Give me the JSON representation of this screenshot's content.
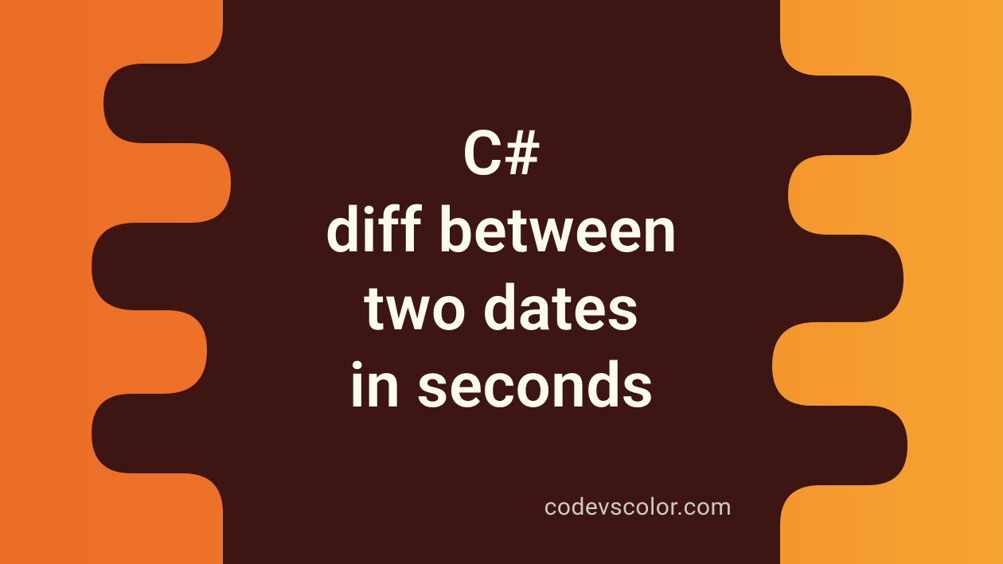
{
  "title_lines": [
    "C#",
    "diff between",
    "two dates",
    "in seconds"
  ],
  "attribution": "codevscolor.com",
  "colors": {
    "blob": "#3d1613",
    "text": "#fdfbee",
    "attribution": "#cfc9c0",
    "bg_left": "#ec6e28",
    "bg_right": "#f7a531"
  }
}
